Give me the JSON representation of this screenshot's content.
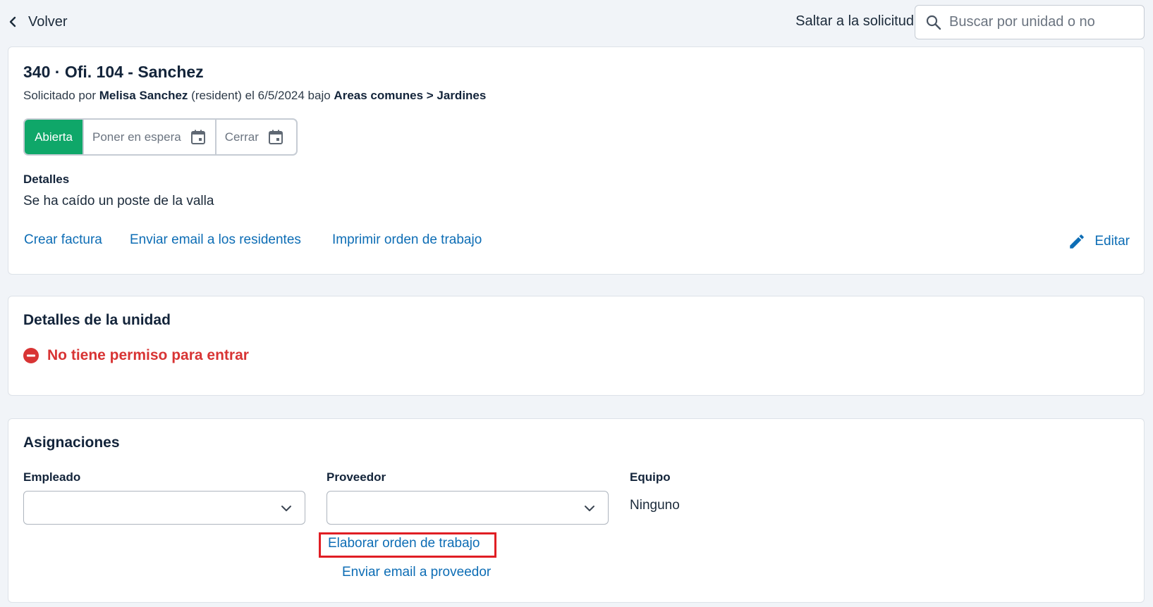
{
  "header": {
    "back_label": "Volver",
    "jump_label": "Saltar a la solicitud",
    "search_placeholder": "Buscar por unidad o no"
  },
  "request": {
    "title": "340 · Ofi. 104 - Sanchez",
    "subtitle_prefix": "Solicitado por",
    "requester": "Melisa Sanchez",
    "requester_role": "(resident) el 6/5/2024 bajo",
    "category": "Areas comunes > Jardines",
    "status": {
      "current": "Abierta",
      "hold": "Poner en espera",
      "close": "Cerrar"
    },
    "details_label": "Detalles",
    "details_text": "Se ha caído un poste de la valla",
    "actions": {
      "create_invoice": "Crear factura",
      "email_residents": "Enviar email a los residentes",
      "print_work_order": "Imprimir orden de trabajo",
      "edit": "Editar"
    }
  },
  "unit_details": {
    "title": "Detalles de la unidad",
    "permission": "No tiene permiso para entrar"
  },
  "assignments": {
    "title": "Asignaciones",
    "employee_label": "Empleado",
    "employee_value": "",
    "vendor_label": "Proveedor",
    "vendor_value": "",
    "team_label": "Equipo",
    "team_value": "Ninguno",
    "create_work_order": "Elaborar orden de trabajo",
    "email_vendor": "Enviar email a proveedor"
  },
  "colors": {
    "accent_link": "#0d6db5",
    "status_open": "#0fa769",
    "danger": "#d83434",
    "highlight": "#e01e24"
  }
}
